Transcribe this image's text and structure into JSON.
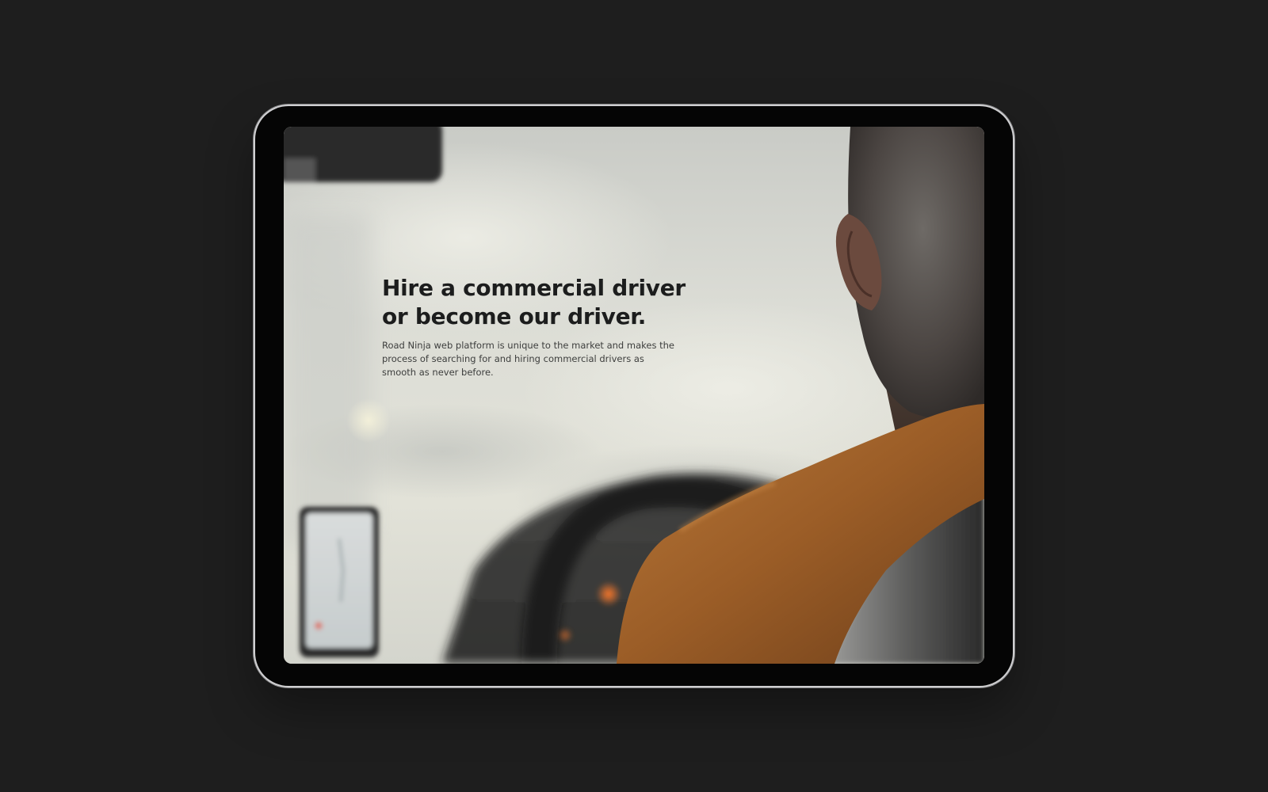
{
  "hero": {
    "title_line1": "Hire a commercial driver",
    "title_line2": "or become our driver.",
    "description": "Road Ninja web platform is unique to the market and makes the process of searching for and hiring commercial drivers as smooth as never before."
  },
  "background_image": {
    "subject": "driver-in-car-photo"
  },
  "colors": {
    "page_background": "#1e1e1e",
    "device_bezel": "#050505",
    "device_frame": "#cfcfd1",
    "headline_text": "#1c1d1d",
    "body_text": "#3d3e3d",
    "sweater_accent": "#a8652a"
  }
}
